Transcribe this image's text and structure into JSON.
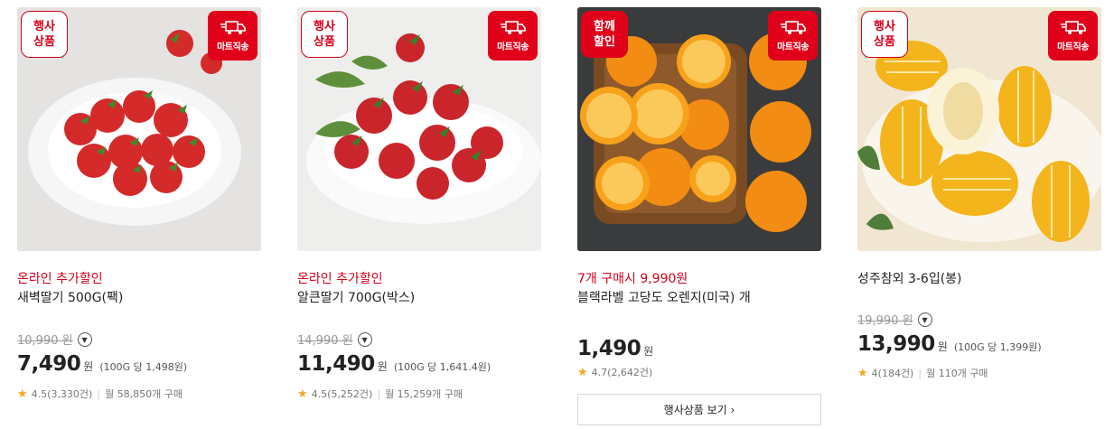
{
  "products": [
    {
      "tag": "행사\n상품",
      "badge": "마트직송",
      "promo": "온라인 추가할인",
      "name": "새벽딸기 500G(팩)",
      "original_price": "10,990 원",
      "price": "7,490",
      "currency": "원",
      "unit_price": "(100G 당 1,498원)",
      "rating": "4.5(3,330건)",
      "monthly": "월 58,850개 구매"
    },
    {
      "tag": "행사\n상품",
      "badge": "마트직송",
      "promo": "온라인 추가할인",
      "name": "알큰딸기 700G(박스)",
      "original_price": "14,990 원",
      "price": "11,490",
      "currency": "원",
      "unit_price": "(100G 당 1,641.4원)",
      "rating": "4.5(5,252건)",
      "monthly": "월 15,259개 구매"
    },
    {
      "tag": "함께\n할인",
      "badge": "마트직송",
      "promo": "7개 구매시 9,990원",
      "name": "블랙라벨 고당도 오렌지(미국) 개",
      "price": "1,490",
      "currency": "원",
      "rating": "4.7(2,642건)",
      "event_button": "행사상품 보기 ›"
    },
    {
      "tag": "행사\n상품",
      "badge": "마트직송",
      "name": "성주참외 3-6입(봉)",
      "original_price": "19,990 원",
      "price": "13,990",
      "currency": "원",
      "unit_price": "(100G 당 1,399원)",
      "rating": "4(184건)",
      "monthly": "월 110개 구매"
    }
  ],
  "icons": {
    "dropdown": "chevron-down-icon",
    "star": "star-icon",
    "truck": "truck-icon"
  },
  "colors": {
    "accent": "#e0001a",
    "promo_text": "#d6001c",
    "star": "#f5a623"
  }
}
